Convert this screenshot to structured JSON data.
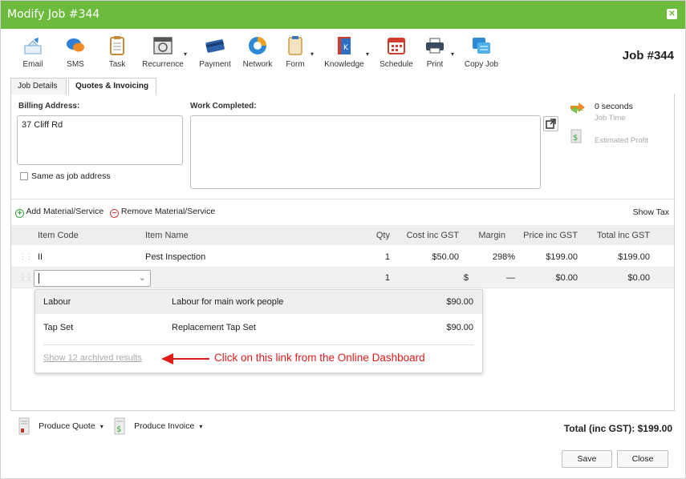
{
  "window": {
    "title": "Modify Job #344"
  },
  "toolbar": {
    "items": [
      {
        "label": "Email",
        "icon": "email-icon"
      },
      {
        "label": "SMS",
        "icon": "sms-icon"
      },
      {
        "label": "Task",
        "icon": "task-icon"
      },
      {
        "label": "Recurrence",
        "icon": "recurrence-icon"
      },
      {
        "label": "Payment",
        "icon": "payment-icon"
      },
      {
        "label": "Network",
        "icon": "network-icon"
      },
      {
        "label": "Form",
        "icon": "form-icon"
      },
      {
        "label": "Knowledge",
        "icon": "knowledge-icon"
      },
      {
        "label": "Schedule",
        "icon": "schedule-icon"
      },
      {
        "label": "Print",
        "icon": "print-icon"
      },
      {
        "label": "Copy Job",
        "icon": "copy-job-icon"
      }
    ],
    "job_number": "Job #344"
  },
  "tabs": [
    {
      "label": "Job Details",
      "active": false
    },
    {
      "label": "Quotes & Invoicing",
      "active": true
    }
  ],
  "billing": {
    "label": "Billing Address:",
    "value": "37 Cliff Rd",
    "same_as_job_label": "Same as job address"
  },
  "work": {
    "label": "Work Completed:",
    "value": ""
  },
  "side": {
    "job_time_value": "0 seconds",
    "job_time_label": "Job Time",
    "estimated_profit_label": "Estimated Profit"
  },
  "actions": {
    "add_label": "Add Material/Service",
    "remove_label": "Remove Material/Service",
    "show_tax_label": "Show Tax"
  },
  "grid": {
    "headers": [
      "Item Code",
      "Item Name",
      "Qty",
      "Cost inc GST",
      "Margin",
      "Price inc GST",
      "Total inc GST"
    ],
    "rows": [
      {
        "code": "II",
        "name": "Pest Inspection",
        "qty": "1",
        "cost": "$50.00",
        "margin": "298%",
        "price": "$199.00",
        "total": "$199.00"
      },
      {
        "code": "",
        "name": "",
        "qty": "1",
        "cost": "$",
        "margin": "—",
        "price": "$0.00",
        "total": "$0.00"
      }
    ]
  },
  "dropdown": {
    "options": [
      {
        "code": "Labour",
        "name": "Labour for main work people",
        "price": "$90.00"
      },
      {
        "code": "Tap Set",
        "name": "Replacement Tap Set",
        "price": "$90.00"
      }
    ],
    "archived_link": "Show 12 archived results"
  },
  "annotation": {
    "text": "Click on this link from the Online Dashboard",
    "color": "#e21b1b"
  },
  "bottom": {
    "produce_quote_label": "Produce Quote",
    "produce_invoice_label": "Produce Invoice",
    "total_label": "Total (inc GST): $199.00",
    "save_label": "Save",
    "close_label": "Close"
  },
  "colors": {
    "titlebar": "#6cbb3c",
    "accent_green": "#3aa23a",
    "remove_red": "#d93a3a"
  }
}
